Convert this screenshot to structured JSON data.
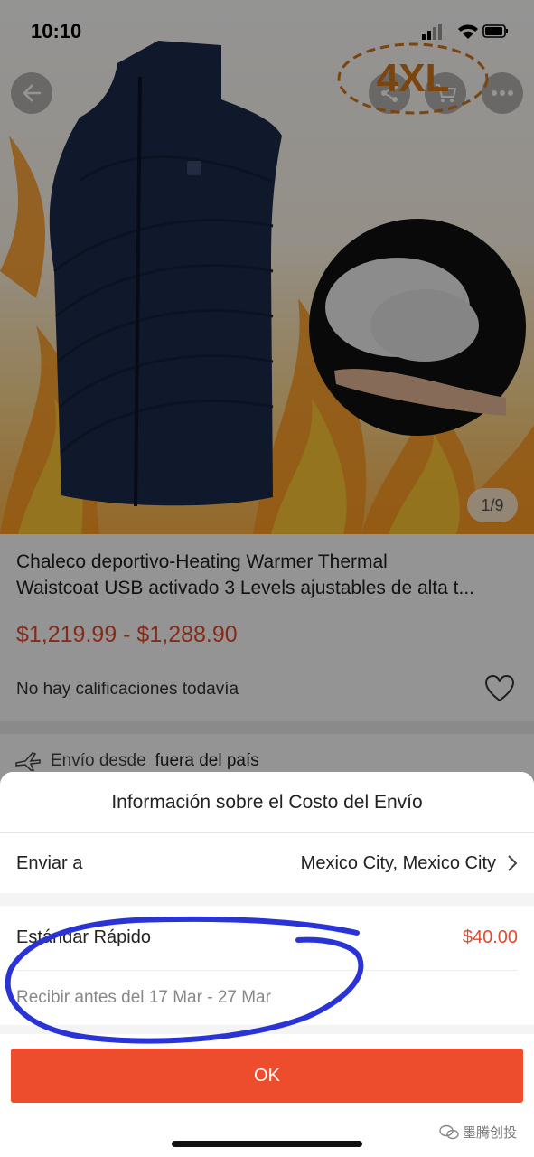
{
  "status_bar": {
    "time": "10:10"
  },
  "hero": {
    "image_counter": "1/9",
    "size_annotation": "4XL"
  },
  "product": {
    "title_line1": "Chaleco deportivo-Heating Warmer Thermal",
    "title_line2": "Waistcoat USB activado 3 Levels ajustables de alta t...",
    "price_range": "$1,219.99 - $1,288.90",
    "rating_text": "No hay calificaciones todavía",
    "shipping_prefix": "Envío desde",
    "shipping_origin": "fuera del país"
  },
  "sheet": {
    "title": "Información sobre el Costo del Envío",
    "ship_to_label": "Enviar a",
    "ship_to_value": "Mexico City, Mexico City",
    "method_name": "Estándar Rápido",
    "method_price": "$40.00",
    "delivery_estimate": "Recibir antes del 17 Mar - 27 Mar",
    "ok_label": "OK"
  },
  "watermark": {
    "text": "墨腾创投"
  },
  "colors": {
    "accent": "#ee4d2d",
    "price": "#e64a2e",
    "annotation_blue": "#2a34d6",
    "annotation_orange": "#d4781a"
  },
  "icons": [
    "back-arrow-icon",
    "share-icon",
    "cart-icon",
    "more-icon",
    "heart-icon",
    "plane-icon",
    "chevron-right-icon",
    "wechat-icon"
  ]
}
